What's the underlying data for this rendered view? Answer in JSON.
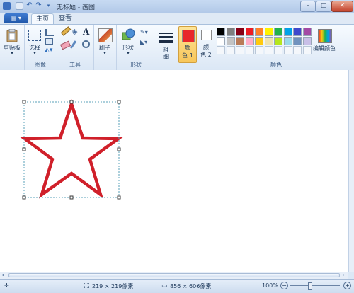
{
  "window": {
    "title": "无标题 - 画图",
    "min_glyph": "–",
    "max_glyph": "□",
    "close_glyph": "✕"
  },
  "tabs": [
    {
      "label": "主页",
      "active": true
    },
    {
      "label": "查看",
      "active": false
    }
  ],
  "ribbon": {
    "clipboard": {
      "label": "剪贴板"
    },
    "image": {
      "group": "图像",
      "select": "选择"
    },
    "tools": {
      "group": "工具"
    },
    "brushes": {
      "label": "刷子"
    },
    "shapes": {
      "group": "形状",
      "shapes_label": "形状"
    },
    "size": {
      "label_line1": "粗",
      "label_line2": "细"
    },
    "color1": {
      "label_line1": "颜",
      "label_line2": "色 1",
      "value": "#e8262a"
    },
    "color2": {
      "label_line1": "颜",
      "label_line2": "色 2",
      "value": "#ffffff"
    },
    "colors": {
      "group": "颜色",
      "edit": "编辑颜色"
    },
    "palette_row1": [
      "#000000",
      "#7f7f7f",
      "#880015",
      "#ed1c24",
      "#ff7f27",
      "#fff200",
      "#22b14c",
      "#00a2e8",
      "#3f48cc",
      "#a349a4"
    ],
    "palette_row2": [
      "#ffffff",
      "#c3c3c3",
      "#b97a57",
      "#ffaec9",
      "#ffc90e",
      "#efe4b0",
      "#b5e61d",
      "#99d9ea",
      "#7092be",
      "#c8bfe7"
    ]
  },
  "star": {
    "stroke": "#d0202a"
  },
  "status": {
    "selection_size": "219 × 219像素",
    "image_size": "856 × 606像素",
    "zoom": "100%"
  }
}
